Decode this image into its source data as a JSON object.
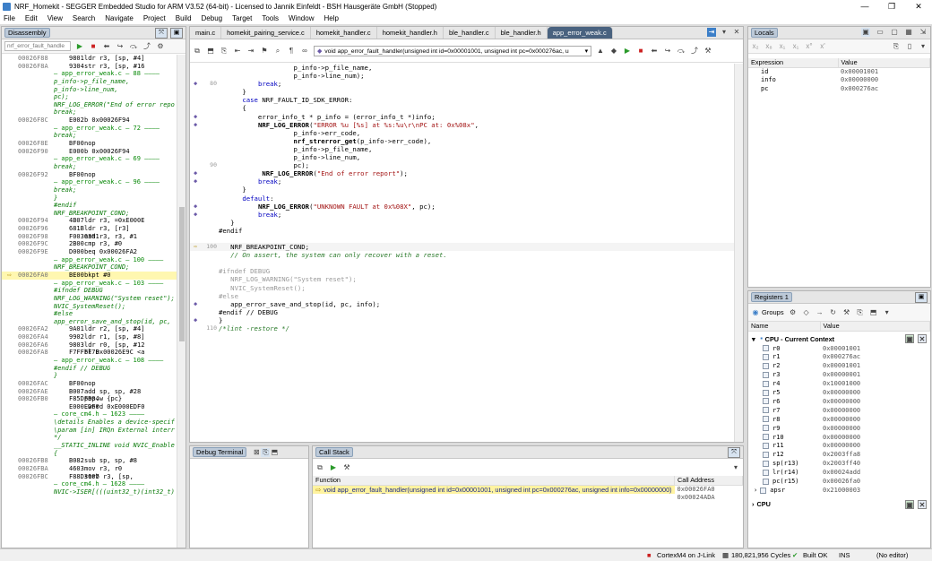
{
  "window": {
    "title": "NRF_Homekit - SEGGER Embedded Studio for ARM V3.52 (64-bit) - Licensed to Jannik Einfeldt - BSH Hausgeräte GmbH (Stopped)"
  },
  "menu": [
    "File",
    "Edit",
    "View",
    "Search",
    "Navigate",
    "Project",
    "Build",
    "Debug",
    "Target",
    "Tools",
    "Window",
    "Help"
  ],
  "disassembly": {
    "tab": "Disassembly",
    "search_placeholder": "nrf_error_fault_handle",
    "lines": [
      {
        "a": "00026F88",
        "o": "9801",
        "t": "ldr r3, [sp, #4]",
        "k": "asm"
      },
      {
        "a": "00026F8A",
        "o": "9304",
        "t": "str r3, [sp, #16",
        "k": "asm"
      },
      {
        "t": "— app_error_weak.c — 88 ————",
        "k": "sep"
      },
      {
        "t": "p_info->p_file_name,",
        "k": "src"
      },
      {
        "t": "p_info->line_num,",
        "k": "src"
      },
      {
        "t": "pc);",
        "k": "src"
      },
      {
        "t": "NRF_LOG_ERROR(\"End of error repo",
        "k": "src"
      },
      {
        "t": "break;",
        "k": "src"
      },
      {
        "a": "00026F8C",
        "o": "E002",
        "t": "b 0x00026F94",
        "k": "asm"
      },
      {
        "t": "— app_error_weak.c — 72 ————",
        "k": "sep"
      },
      {
        "t": "break;",
        "k": "src"
      },
      {
        "a": "00026F8E",
        "o": "BF00",
        "t": "nop",
        "k": "asm"
      },
      {
        "a": "00026F90",
        "o": "E000",
        "t": "b 0x00026F94",
        "k": "asm"
      },
      {
        "t": "— app_error_weak.c — 69 ————",
        "k": "sep"
      },
      {
        "t": "break;",
        "k": "src"
      },
      {
        "a": "00026F92",
        "o": "BF00",
        "t": "nop",
        "k": "asm"
      },
      {
        "t": "— app_error_weak.c — 96 ————",
        "k": "sep"
      },
      {
        "t": "break;",
        "k": "src"
      },
      {
        "t": "}",
        "k": "src"
      },
      {
        "t": "#endif",
        "k": "src"
      },
      {
        "t": "NRF_BREAKPOINT_COND;",
        "k": "src"
      },
      {
        "a": "00026F94",
        "o": "4B07",
        "t": "ldr r3, =0xE000E",
        "k": "asm"
      },
      {
        "a": "00026F96",
        "o": "681B",
        "t": "ldr r3, [r3]",
        "k": "asm"
      },
      {
        "a": "00026F98",
        "o": "F0030301",
        "t": "and r3, r3, #1",
        "k": "asm"
      },
      {
        "a": "00026F9C",
        "o": "2B00",
        "t": "cmp r3, #0",
        "k": "asm"
      },
      {
        "a": "00026F9E",
        "o": "D000",
        "t": "beq 0x00026FA2",
        "k": "asm"
      },
      {
        "t": "— app_error_weak.c — 100 ————",
        "k": "sep"
      },
      {
        "t": "NRF_BREAKPOINT_COND;",
        "k": "src"
      },
      {
        "a": "00026FA0",
        "o": "BE00",
        "t": "bkpt #0",
        "k": "asm",
        "cur": true
      },
      {
        "t": "— app_error_weak.c — 103 ————",
        "k": "sep"
      },
      {
        "t": "#ifndef DEBUG",
        "k": "src"
      },
      {
        "t": "NRF_LOG_WARNING(\"System reset\");",
        "k": "src"
      },
      {
        "t": "NVIC_SystemReset();",
        "k": "src"
      },
      {
        "t": "#else",
        "k": "src"
      },
      {
        "t": "app_error_save_and_stop(id, pc,",
        "k": "src"
      },
      {
        "a": "00026FA2",
        "o": "9A01",
        "t": "ldr r2, [sp, #4]",
        "k": "asm"
      },
      {
        "a": "00026FA4",
        "o": "9902",
        "t": "ldr r1, [sp, #8]",
        "k": "asm"
      },
      {
        "a": "00026FA6",
        "o": "9803",
        "t": "ldr r0, [sp, #12",
        "k": "asm"
      },
      {
        "a": "00026FA8",
        "o": "F7FFFF7B",
        "t": "bl 0x00026E9C <a",
        "k": "asm"
      },
      {
        "t": "— app_error_weak.c — 108 ————",
        "k": "sep"
      },
      {
        "t": "#endif // DEBUG",
        "k": "src"
      },
      {
        "t": "}",
        "k": "src"
      },
      {
        "a": "00026FAC",
        "o": "BF00",
        "t": "nop",
        "k": "asm"
      },
      {
        "a": "00026FAE",
        "o": "B007",
        "t": "add sp, sp, #28",
        "k": "asm"
      },
      {
        "a": "00026FB0",
        "o": "F85DFB04",
        "t": "pop.w {pc}",
        "k": "asm"
      },
      {
        "a": "",
        "o": "E000EDF0",
        "t": ".word 0xE000EDF0",
        "k": "asm"
      },
      {
        "t": "— core_cm4.h — 1623 ————",
        "k": "sep"
      },
      {
        "t": "\\details Enables a device-specif",
        "k": "src"
      },
      {
        "t": "\\param [in] IRQn External interr",
        "k": "src"
      },
      {
        "t": "*/",
        "k": "src"
      },
      {
        "t": "__STATIC_INLINE void NVIC_Enable",
        "k": "src"
      },
      {
        "t": "{",
        "k": "src"
      },
      {
        "a": "00026FB8",
        "o": "B082",
        "t": "sub sp, sp, #8",
        "k": "asm"
      },
      {
        "a": "00026FBA",
        "o": "4603",
        "t": "mov r3, r0",
        "k": "asm"
      },
      {
        "a": "00026FBC",
        "o": "F88D3007",
        "t": "strb r3, [sp,",
        "k": "asm"
      },
      {
        "t": "— core_cm4.h — 1628 ————",
        "k": "sep"
      },
      {
        "t": "NVIC->ISER[(((uint32_t)(int32_t)",
        "k": "src"
      }
    ]
  },
  "editor": {
    "tabs": [
      "main.c",
      "homekit_pairing_service.c",
      "homekit_handler.c",
      "homekit_handler.h",
      "ble_handler.c",
      "ble_handler.h",
      "app_error_weak.c"
    ],
    "function_select": "void app_error_fault_handler(unsigned int id=0x00001001, unsigned int pc=0x000276ac, u",
    "lines": [
      {
        "n": "",
        "b": "",
        "h": "                   p_info->p_file_name,"
      },
      {
        "n": "",
        "b": "",
        "h": "                   p_info->line_num);"
      },
      {
        "n": "80",
        "b": "◆",
        "h": "          <span class=\"kw\">break</span>;"
      },
      {
        "n": "",
        "b": "",
        "h": "      }"
      },
      {
        "n": "",
        "b": "",
        "h": "      <span class=\"kw\">case</span> NRF_FAULT_ID_SDK_ERROR:"
      },
      {
        "n": "",
        "b": "",
        "h": "      {"
      },
      {
        "n": "",
        "b": "◆",
        "h": "          error_info_t * p_info = (error_info_t *)info;"
      },
      {
        "n": "",
        "b": "◆",
        "h": "          <span class=\"fn\">NRF_LOG_ERROR</span>(<span class=\"st\">\"ERROR %u [%s] at %s:%u\\r\\nPC at: 0x%08x\"</span>,"
      },
      {
        "n": "",
        "b": "",
        "h": "                   p_info->err_code,"
      },
      {
        "n": "",
        "b": "",
        "h": "                   <span class=\"fn\">nrf_strerror_get</span>(p_info->err_code),"
      },
      {
        "n": "",
        "b": "",
        "h": "                   p_info->p_file_name,"
      },
      {
        "n": "",
        "b": "",
        "h": "                   p_info->line_num,"
      },
      {
        "n": "90",
        "b": "",
        "h": "                   pc);"
      },
      {
        "n": "",
        "b": "◆",
        "h": "           <span class=\"fn\">NRF_LOG_ERROR</span>(<span class=\"st\">\"End of error report\"</span>);"
      },
      {
        "n": "",
        "b": "◆",
        "h": "          <span class=\"kw\">break</span>;"
      },
      {
        "n": "",
        "b": "",
        "h": "      }"
      },
      {
        "n": "",
        "b": "",
        "h": "      <span class=\"kw\">default</span>:"
      },
      {
        "n": "",
        "b": "◆",
        "h": "          <span class=\"fn\">NRF_LOG_ERROR</span>(<span class=\"st\">\"UNKNOWN FAULT at 0x%08X\"</span>, pc);"
      },
      {
        "n": "",
        "b": "◆",
        "h": "          <span class=\"kw\">break</span>;"
      },
      {
        "n": "",
        "b": "",
        "h": "   }"
      },
      {
        "n": "",
        "b": "",
        "h": "#endif"
      },
      {
        "n": "",
        "b": "",
        "h": ""
      },
      {
        "n": "100",
        "b": "⇨",
        "h": "   NRF_BREAKPOINT_COND;",
        "hl": true
      },
      {
        "n": "",
        "b": "",
        "h": "   <span class=\"cm\">// On assert, the system can only recover with a reset.</span>"
      },
      {
        "n": "",
        "b": "",
        "h": ""
      },
      {
        "n": "",
        "b": "",
        "h": "<span class=\"gry\">#ifndef DEBUG</span>"
      },
      {
        "n": "",
        "b": "",
        "h": "<span class=\"gry\">   NRF_LOG_WARNING(\"System reset\");</span>"
      },
      {
        "n": "",
        "b": "",
        "h": "<span class=\"gry\">   NVIC_SystemReset();</span>"
      },
      {
        "n": "",
        "b": "",
        "h": "<span class=\"gry\">#else</span>"
      },
      {
        "n": "",
        "b": "◆",
        "h": "   app_error_save_and_stop(id, pc, info);"
      },
      {
        "n": "",
        "b": "",
        "h": "#endif // DEBUG"
      },
      {
        "n": "",
        "b": "◆",
        "h": "}"
      },
      {
        "n": "110",
        "b": "",
        "h": "<span class=\"cm\">/*lint -restore */</span>"
      }
    ]
  },
  "locals": {
    "tab": "Locals",
    "col_expr": "Expression",
    "col_val": "Value",
    "rows": [
      {
        "n": "id",
        "v": "0x00001001"
      },
      {
        "n": "info",
        "v": "0x00000000"
      },
      {
        "n": "pc",
        "v": "0x000276ac"
      }
    ]
  },
  "registers": {
    "tab": "Registers 1",
    "groups": "Groups",
    "col_name": "Name",
    "col_val": "Value",
    "group_title": "CPU - Current Context",
    "cpu_group": "CPU",
    "rows": [
      {
        "n": "r0",
        "v": "0x00001001"
      },
      {
        "n": "r1",
        "v": "0x000276ac"
      },
      {
        "n": "r2",
        "v": "0x00001001"
      },
      {
        "n": "r3",
        "v": "0x00000001"
      },
      {
        "n": "r4",
        "v": "0x10001000"
      },
      {
        "n": "r5",
        "v": "0x00000000"
      },
      {
        "n": "r6",
        "v": "0x00000000"
      },
      {
        "n": "r7",
        "v": "0x00000000"
      },
      {
        "n": "r8",
        "v": "0x00000000"
      },
      {
        "n": "r9",
        "v": "0x00000000"
      },
      {
        "n": "r10",
        "v": "0x00000000"
      },
      {
        "n": "r11",
        "v": "0x00000000"
      },
      {
        "n": "r12",
        "v": "0x2003ffa8"
      },
      {
        "n": "sp(r13)",
        "v": "0x2003ff40"
      },
      {
        "n": "lr(r14)",
        "v": "0x00024add"
      },
      {
        "n": "pc(r15)",
        "v": "0x00026fa0"
      },
      {
        "n": "apsr",
        "v": "0x21000003"
      }
    ]
  },
  "debug_terminal": {
    "tab": "Debug Terminal"
  },
  "callstack": {
    "tab": "Call Stack",
    "col_fn": "Function",
    "col_addr": "Call Address",
    "rows": [
      {
        "f": "void app_error_fault_handler(unsigned int id=0x00001001, unsigned int pc=0x000276ac, unsigned int info=0x00000000)",
        "a": "0x00026FA0"
      },
      {
        "f": "",
        "a": "0x00024ADA"
      }
    ]
  },
  "status": {
    "target": "CortexM4 on J-Link",
    "cycles": "180,821,956 Cycles",
    "build": "Built OK",
    "ins": "INS",
    "editor": "(No editor)"
  }
}
